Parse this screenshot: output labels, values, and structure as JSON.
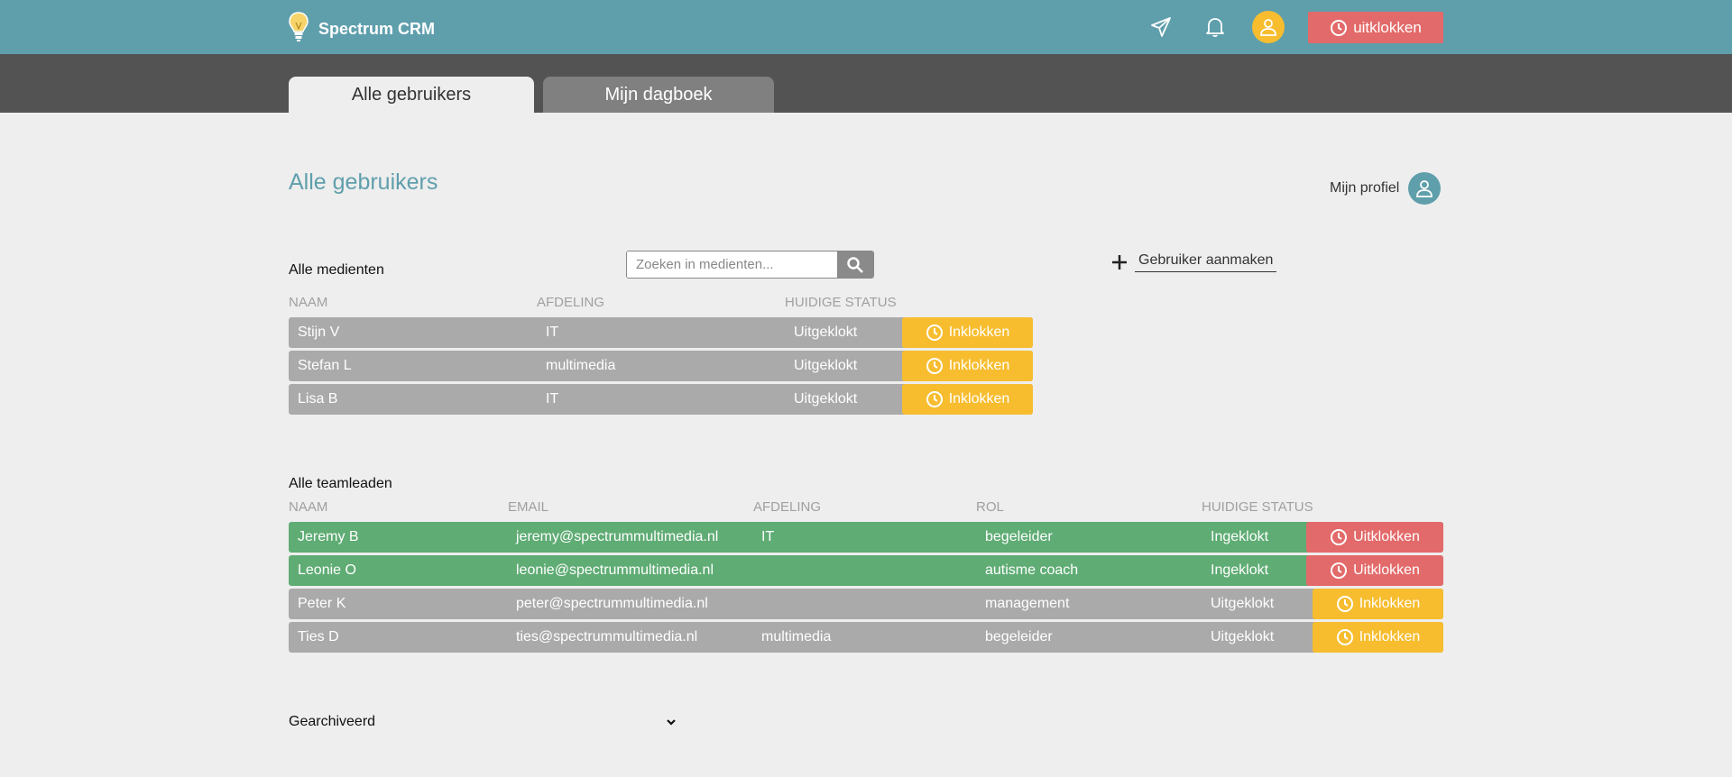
{
  "app": {
    "name": "Spectrum CRM"
  },
  "topbar": {
    "uitklokken_label": "uitklokken"
  },
  "tabs": [
    {
      "label": "Alle gebruikers",
      "active": true
    },
    {
      "label": "Mijn dagboek",
      "active": false
    }
  ],
  "page": {
    "title": "Alle gebruikers",
    "profile_label": "Mijn profiel"
  },
  "medienten": {
    "title": "Alle medienten",
    "search_placeholder": "Zoeken in medienten...",
    "create_label": "Gebruiker aanmaken",
    "columns": [
      "NAAM",
      "AFDELING",
      "HUIDIGE STATUS"
    ],
    "rows": [
      {
        "naam": "Stijn V",
        "afdeling": "IT",
        "status": "Uitgeklokt",
        "action": "Inklokken"
      },
      {
        "naam": "Stefan L",
        "afdeling": "multimedia",
        "status": "Uitgeklokt",
        "action": "Inklokken"
      },
      {
        "naam": "Lisa B",
        "afdeling": "IT",
        "status": "Uitgeklokt",
        "action": "Inklokken"
      }
    ]
  },
  "teamleaden": {
    "title": "Alle teamleaden",
    "columns": [
      "NAAM",
      "EMAIL",
      "AFDELING",
      "ROL",
      "HUIDIGE STATUS"
    ],
    "rows": [
      {
        "naam": "Jeremy B",
        "email": "jeremy@spectrummultimedia.nl",
        "afdeling": "IT",
        "rol": "begeleider",
        "status": "Ingeklokt",
        "action": "Uitklokken"
      },
      {
        "naam": "Leonie O",
        "email": "leonie@spectrummultimedia.nl",
        "afdeling": "",
        "rol": "autisme coach",
        "status": "Ingeklokt",
        "action": "Uitklokken"
      },
      {
        "naam": "Peter K",
        "email": "peter@spectrummultimedia.nl",
        "afdeling": "",
        "rol": "management",
        "status": "Uitgeklokt",
        "action": "Inklokken"
      },
      {
        "naam": "Ties D",
        "email": "ties@spectrummultimedia.nl",
        "afdeling": "multimedia",
        "rol": "begeleider",
        "status": "Uitgeklokt",
        "action": "Inklokken"
      }
    ]
  },
  "archive": {
    "label": "Gearchiveerd"
  },
  "colors": {
    "accent": "#5f9fac",
    "header_bg": "#535353",
    "green": "#5fac74",
    "grey_row": "#aaaaaa",
    "yellow": "#f7bd2f",
    "red": "#e36a6a"
  }
}
